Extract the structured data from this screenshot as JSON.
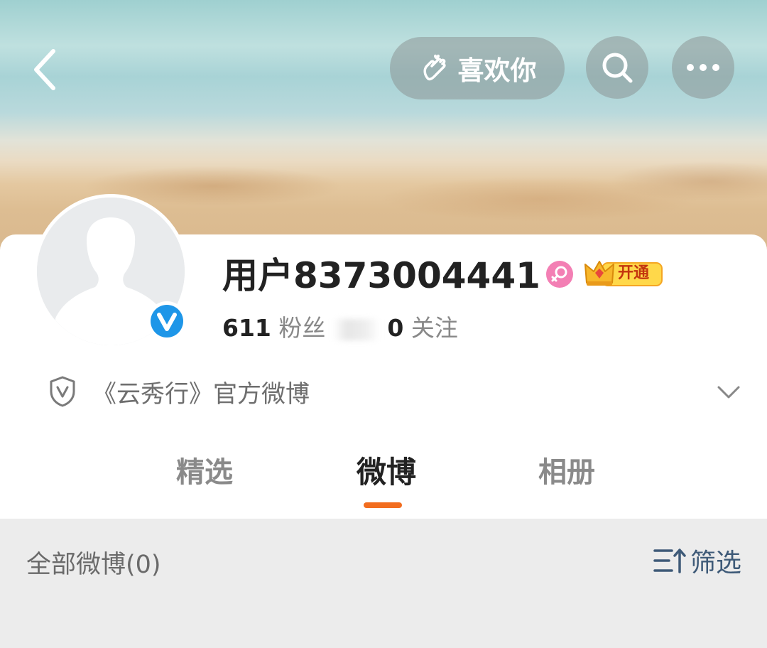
{
  "header": {
    "like_label": "喜欢你"
  },
  "profile": {
    "username": "用户8373004441",
    "vip_label": "开通",
    "fans_count": "611",
    "fans_label": "粉丝",
    "following_count": "0",
    "following_label": "关注",
    "description": "《云秀行》官方微博"
  },
  "tabs": [
    {
      "label": "精选",
      "active": false
    },
    {
      "label": "微博",
      "active": true
    },
    {
      "label": "相册",
      "active": false
    }
  ],
  "filter": {
    "all_label": "全部微博(0)",
    "filter_label": "筛选"
  },
  "icons": {
    "back": "back-arrow-icon",
    "like": "heart-hand-icon",
    "search": "search-icon",
    "more": "more-dots-icon",
    "verify": "verified-v-icon",
    "gender": "female-icon",
    "vip": "crown-icon",
    "shield": "shield-v-icon",
    "expand": "chevron-down-icon",
    "filter": "filter-sort-icon"
  },
  "colors": {
    "accent": "#f26d1f",
    "verify_blue": "#1e96e8",
    "gender_pink": "#f37fb4",
    "vip_gold": "#f5a623",
    "filter_blue": "#3e5a78"
  }
}
